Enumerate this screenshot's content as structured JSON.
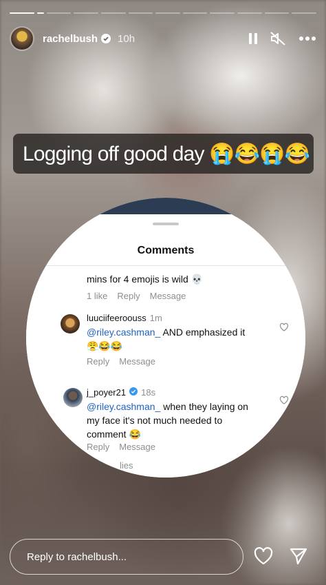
{
  "story": {
    "username": "rachelbush",
    "time_ago": "10h",
    "segments": 12,
    "caption": "Logging off good day 😭😂😭😂"
  },
  "comments_sheet": {
    "title": "Comments",
    "items": [
      {
        "text": "mins for 4 emojis is wild 💀",
        "likes": "1 like",
        "reply": "Reply",
        "message": "Message"
      },
      {
        "username": "luuciifeeroouss",
        "time": "1m",
        "mention": "@riley.cashman_",
        "text": " AND emphasized it",
        "emojis": "😤😂😂",
        "reply": "Reply",
        "message": "Message"
      },
      {
        "username": "j_poyer21",
        "time": "18s",
        "mention": "@riley.cashman_",
        "text_line1": " when they laying on",
        "text_line2": "my face it's not much needed to",
        "text_line3": "comment 😂",
        "reply": "Reply",
        "message": "Message"
      }
    ],
    "partial_next": "lies"
  },
  "reply_bar": {
    "placeholder": "Reply to rachelbush..."
  },
  "icons": [
    "pause-icon",
    "mute-icon",
    "more-icon",
    "heart-icon",
    "send-icon"
  ]
}
